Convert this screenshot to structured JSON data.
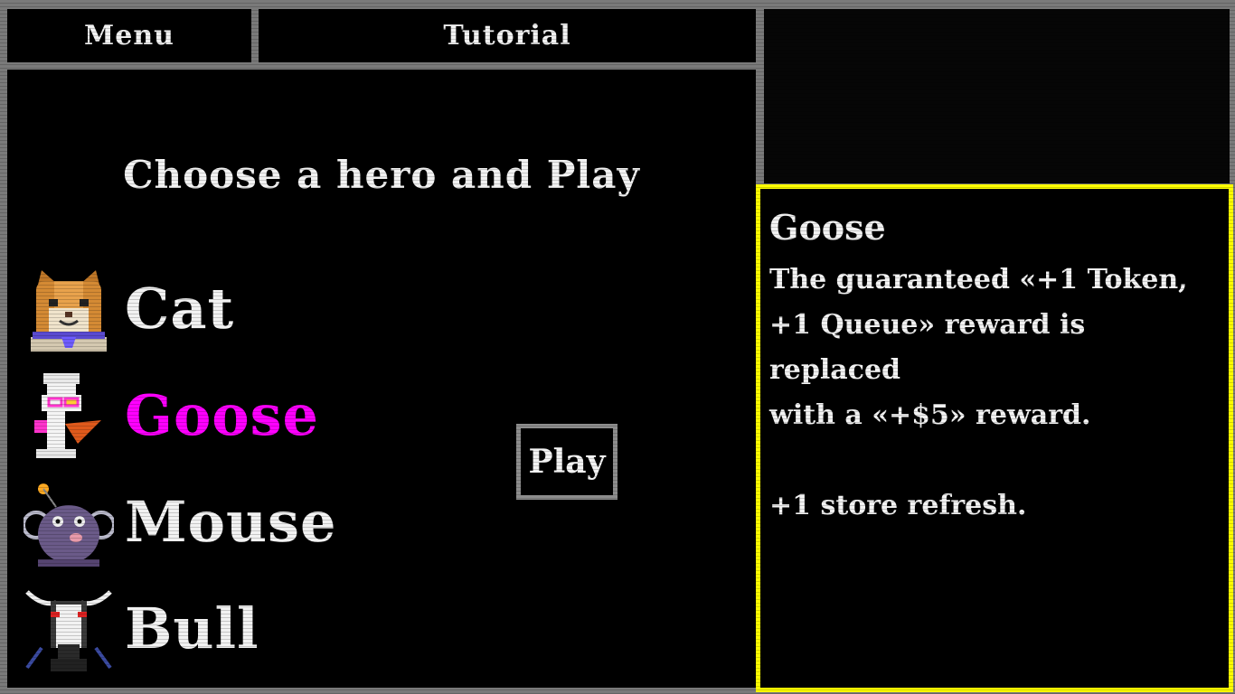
{
  "tabs": {
    "menu_label": "Menu",
    "tutorial_label": "Tutorial"
  },
  "main": {
    "title": "Choose a hero and Play",
    "play_label": "Play",
    "heroes": [
      {
        "name": "Cat",
        "selected": false,
        "icon": "cat-portrait"
      },
      {
        "name": "Goose",
        "selected": true,
        "icon": "goose-portrait"
      },
      {
        "name": "Mouse",
        "selected": false,
        "icon": "mouse-portrait"
      },
      {
        "name": "Bull",
        "selected": false,
        "icon": "bull-portrait"
      }
    ]
  },
  "info": {
    "name": "Goose",
    "description": "The guaranteed «+1 Token,\n+1 Queue» reward is replaced\nwith a «+$5» reward.\n\n+1 store refresh."
  },
  "colors": {
    "selected": "#ff00ff",
    "highlight_border": "#ffff00",
    "frame": "#7a7a7a"
  }
}
